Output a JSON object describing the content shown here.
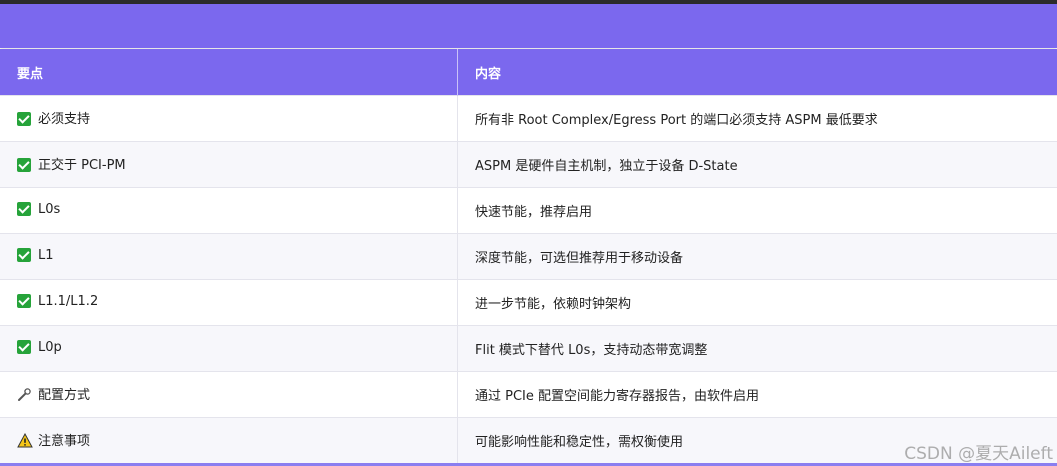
{
  "table": {
    "headers": [
      "要点",
      "内容"
    ],
    "rows": [
      {
        "icon": "check-icon",
        "point": "必须支持",
        "content": "所有非 Root Complex/Egress Port 的端口必须支持 ASPM 最低要求"
      },
      {
        "icon": "check-icon",
        "point": "正交于 PCI-PM",
        "content": "ASPM 是硬件自主机制，独立于设备 D-State"
      },
      {
        "icon": "check-icon",
        "point": "L0s",
        "content": "快速节能，推荐启用"
      },
      {
        "icon": "check-icon",
        "point": "L1",
        "content": "深度节能，可选但推荐用于移动设备"
      },
      {
        "icon": "check-icon",
        "point": "L1.1/L1.2",
        "content": "进一步节能，依赖时钟架构"
      },
      {
        "icon": "check-icon",
        "point": "L0p",
        "content": "Flit 模式下替代 L0s，支持动态带宽调整"
      },
      {
        "icon": "wrench-icon",
        "point": "配置方式",
        "content": "通过 PCIe 配置空间能力寄存器报告，由软件启用"
      },
      {
        "icon": "warning-icon",
        "point": "注意事项",
        "content": "可能影响性能和稳定性，需权衡使用"
      }
    ]
  },
  "watermark": "CSDN @夏天Aileft",
  "colors": {
    "header": "#7b68ee",
    "check": "#26a33a",
    "warning": "#f5c518"
  }
}
